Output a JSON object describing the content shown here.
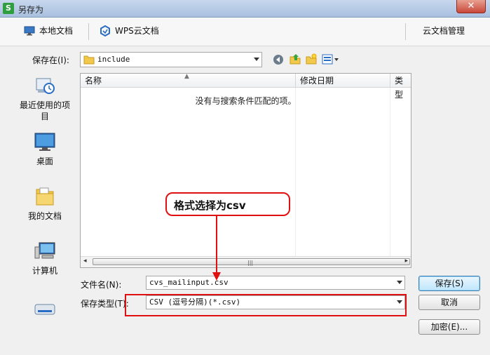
{
  "window": {
    "title": "另存为",
    "close_label": "✕"
  },
  "topbar": {
    "local_docs": "本地文档",
    "wps_cloud": "WPS云文档",
    "cloud_manage": "云文档管理"
  },
  "save_in": {
    "label": "保存在(I):",
    "value": "include"
  },
  "places": [
    {
      "label": "最近使用的项目"
    },
    {
      "label": "桌面"
    },
    {
      "label": "我的文档"
    },
    {
      "label": "计算机"
    },
    {
      "label": ""
    }
  ],
  "filelist": {
    "columns": [
      "名称",
      "修改日期",
      "类型"
    ],
    "empty_message": "没有与搜索条件匹配的项。"
  },
  "filename": {
    "label": "文件名(N):",
    "value": "cvs_mailinput.csv"
  },
  "filetype": {
    "label": "保存类型(T):",
    "value": "CSV (逗号分隔)(*.csv)"
  },
  "buttons": {
    "save": "保存(S)",
    "cancel": "取消",
    "encrypt": "加密(E)..."
  },
  "annotation": {
    "text": "格式选择为csv",
    "color": "#e01010"
  }
}
